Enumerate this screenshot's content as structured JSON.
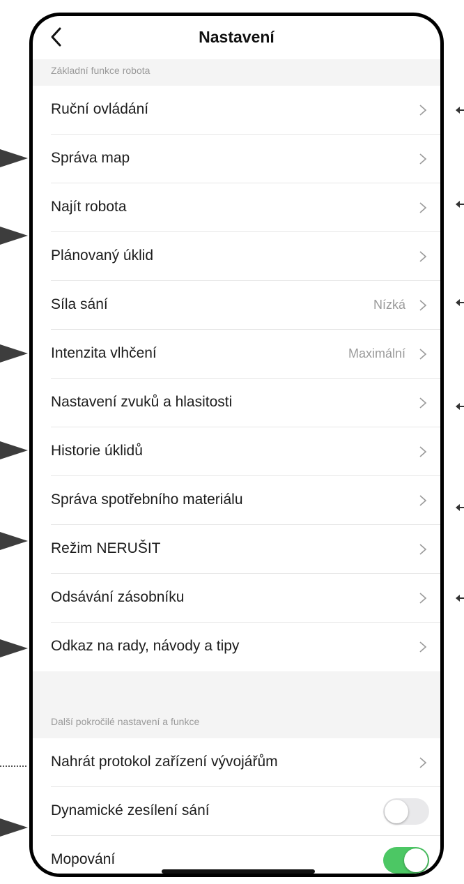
{
  "header": {
    "title": "Nastavení",
    "back_icon": "chevron-left-icon"
  },
  "sections": {
    "basic": "Základní funkce robota",
    "advanced": "Další pokročilé nastavení a funkce"
  },
  "rows": {
    "manual_control": {
      "label": "Ruční ovládání"
    },
    "map_management": {
      "label": "Správa map"
    },
    "find_robot": {
      "label": "Najít robota"
    },
    "scheduled_cleaning": {
      "label": "Plánovaný úklid"
    },
    "suction_power": {
      "label": "Síla sání",
      "value": "Nízká"
    },
    "mop_humidity": {
      "label": "Intenzita vlhčení",
      "value": "Maximální"
    },
    "sound_settings": {
      "label": "Nastavení zvuků a hlasitosti"
    },
    "cleaning_history": {
      "label": "Historie úklidů"
    },
    "consumables": {
      "label": "Správa spotřebního materiálu"
    },
    "dnd_mode": {
      "label": "Režim NERUŠIT"
    },
    "bin_emptying": {
      "label": "Odsávání zásobníku"
    },
    "tips_link": {
      "label": "Odkaz na rady, návody a tipy"
    },
    "upload_logs": {
      "label": "Nahrát protokol zařízení vývojářům"
    },
    "dynamic_suction": {
      "label": "Dynamické zesílení sání",
      "enabled": false
    },
    "mopping": {
      "label": "Mopování",
      "enabled": true
    }
  },
  "colors": {
    "toggle_on": "#4cc764",
    "toggle_off": "#e9e9eb",
    "section_bg": "#f4f4f4",
    "secondary_text": "#9a9a9a"
  }
}
